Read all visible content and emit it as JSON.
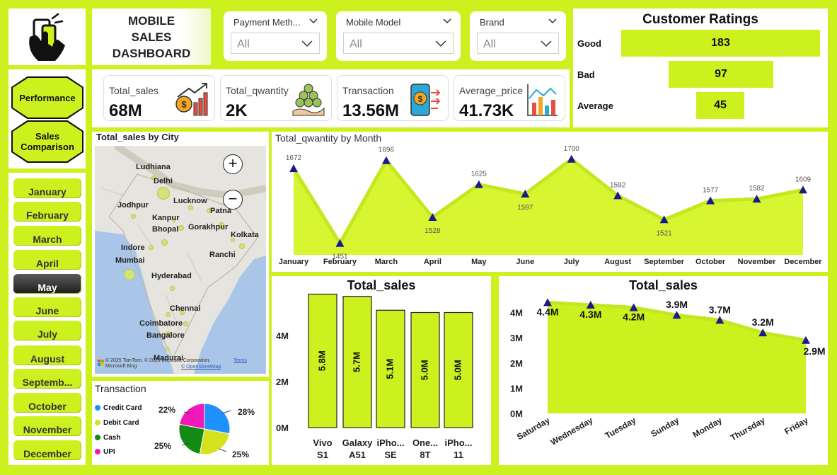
{
  "dashboard": {
    "title_lines": [
      "MOBILE",
      "SALES",
      "DASHBOARD"
    ],
    "logo_icon": "hand-phone-icon"
  },
  "slicers": [
    {
      "label": "Payment Meth...",
      "value": "All"
    },
    {
      "label": "Mobile Model",
      "value": "All"
    },
    {
      "label": "Brand",
      "value": "All"
    }
  ],
  "ratings": {
    "title": "Customer Ratings",
    "items": [
      {
        "label": "Good",
        "value": 183
      },
      {
        "label": "Bad",
        "value": 97
      },
      {
        "label": "Average",
        "value": 45
      }
    ]
  },
  "nav": {
    "performance": "Performance",
    "sales_comparison_lines": [
      "Sales",
      "Comparison"
    ]
  },
  "months": {
    "items": [
      "January",
      "February",
      "March",
      "April",
      "May",
      "June",
      "July",
      "August",
      "Septemb...",
      "October",
      "November",
      "December"
    ],
    "selected": "May"
  },
  "kpis": [
    {
      "label": "Total_sales",
      "value": "68M",
      "icon": "money-growth-icon"
    },
    {
      "label": "Total_qwantity",
      "value": "2K",
      "icon": "coin-stack-hand-icon"
    },
    {
      "label": "Transaction",
      "value": "13.56M",
      "icon": "phone-payment-icon"
    },
    {
      "label": "Average_price",
      "value": "41.73K",
      "icon": "bar-chart-icon"
    }
  ],
  "map": {
    "title": "Total_sales by City",
    "cities": [
      "Ludhiana",
      "Delhi",
      "Jodhpur",
      "Lucknow",
      "Patna",
      "Kanpur",
      "Gorakhpur",
      "Bhopal",
      "Kolkata",
      "Indore",
      "Ranchi",
      "Mumbai",
      "Hyderabad",
      "Chennai",
      "Coimbatore",
      "Bangalore",
      "Madurai"
    ],
    "attribution": "© 2025 TomTom, © 2025 Microsoft Corporation,",
    "terms": "Terms",
    "osm": "© OpenStreetMap",
    "bing": "Microsoft Bing",
    "zoom_in": "+",
    "zoom_out": "−"
  },
  "colors": {
    "accent": "#cdf11f",
    "marker": "#1a1a8c",
    "area_fill": "#d8f531",
    "credit_card": "#1e90ff",
    "debit_card": "#d4e21f",
    "cash": "#138a13",
    "upi": "#f018b8"
  },
  "chart_data": [
    {
      "type": "area",
      "title": "Total_qwantity by Month",
      "categories": [
        "January",
        "February",
        "March",
        "April",
        "May",
        "June",
        "July",
        "August",
        "September",
        "October",
        "November",
        "December"
      ],
      "values": [
        1672,
        1451,
        1696,
        1528,
        1625,
        1597,
        1700,
        1592,
        1521,
        1577,
        1582,
        1609
      ],
      "ylim": [
        1440,
        1710
      ]
    },
    {
      "type": "bar",
      "title": "Total_sales",
      "categories": [
        "Vivo S1",
        "Galaxy A51",
        "iPho... SE",
        "One... 8T",
        "iPho... 11"
      ],
      "category_lines": [
        [
          "Vivo",
          "S1"
        ],
        [
          "Galaxy",
          "A51"
        ],
        [
          "iPho...",
          "SE"
        ],
        [
          "One...",
          "8T"
        ],
        [
          "iPho...",
          "11"
        ]
      ],
      "values": [
        5.8,
        5.7,
        5.1,
        5.0,
        5.0
      ],
      "labels": [
        "5.8M",
        "5.7M",
        "5.1M",
        "5.0M",
        "5.0M"
      ],
      "yticks": [
        "0M",
        "2M",
        "4M"
      ],
      "ylim": [
        0,
        6
      ]
    },
    {
      "type": "area",
      "title": "Total_sales",
      "categories": [
        "Saturday",
        "Wednesday",
        "Tuesday",
        "Sunday",
        "Monday",
        "Thursday",
        "Friday"
      ],
      "values": [
        4.4,
        4.3,
        4.2,
        3.9,
        3.7,
        3.2,
        2.9
      ],
      "labels": [
        "4.4M",
        "4.3M",
        "4.2M",
        "3.9M",
        "3.7M",
        "3.2M",
        "2.9M"
      ],
      "yticks": [
        "0M",
        "1M",
        "2M",
        "3M",
        "4M"
      ],
      "ylim": [
        0,
        4.6
      ]
    },
    {
      "type": "pie",
      "title": "Transaction",
      "legend": [
        "Credit Card",
        "Debit Card",
        "Cash",
        "UPI"
      ],
      "values": [
        28,
        25,
        25,
        22
      ],
      "labels": [
        "28%",
        "25%",
        "25%",
        "22%"
      ]
    }
  ]
}
